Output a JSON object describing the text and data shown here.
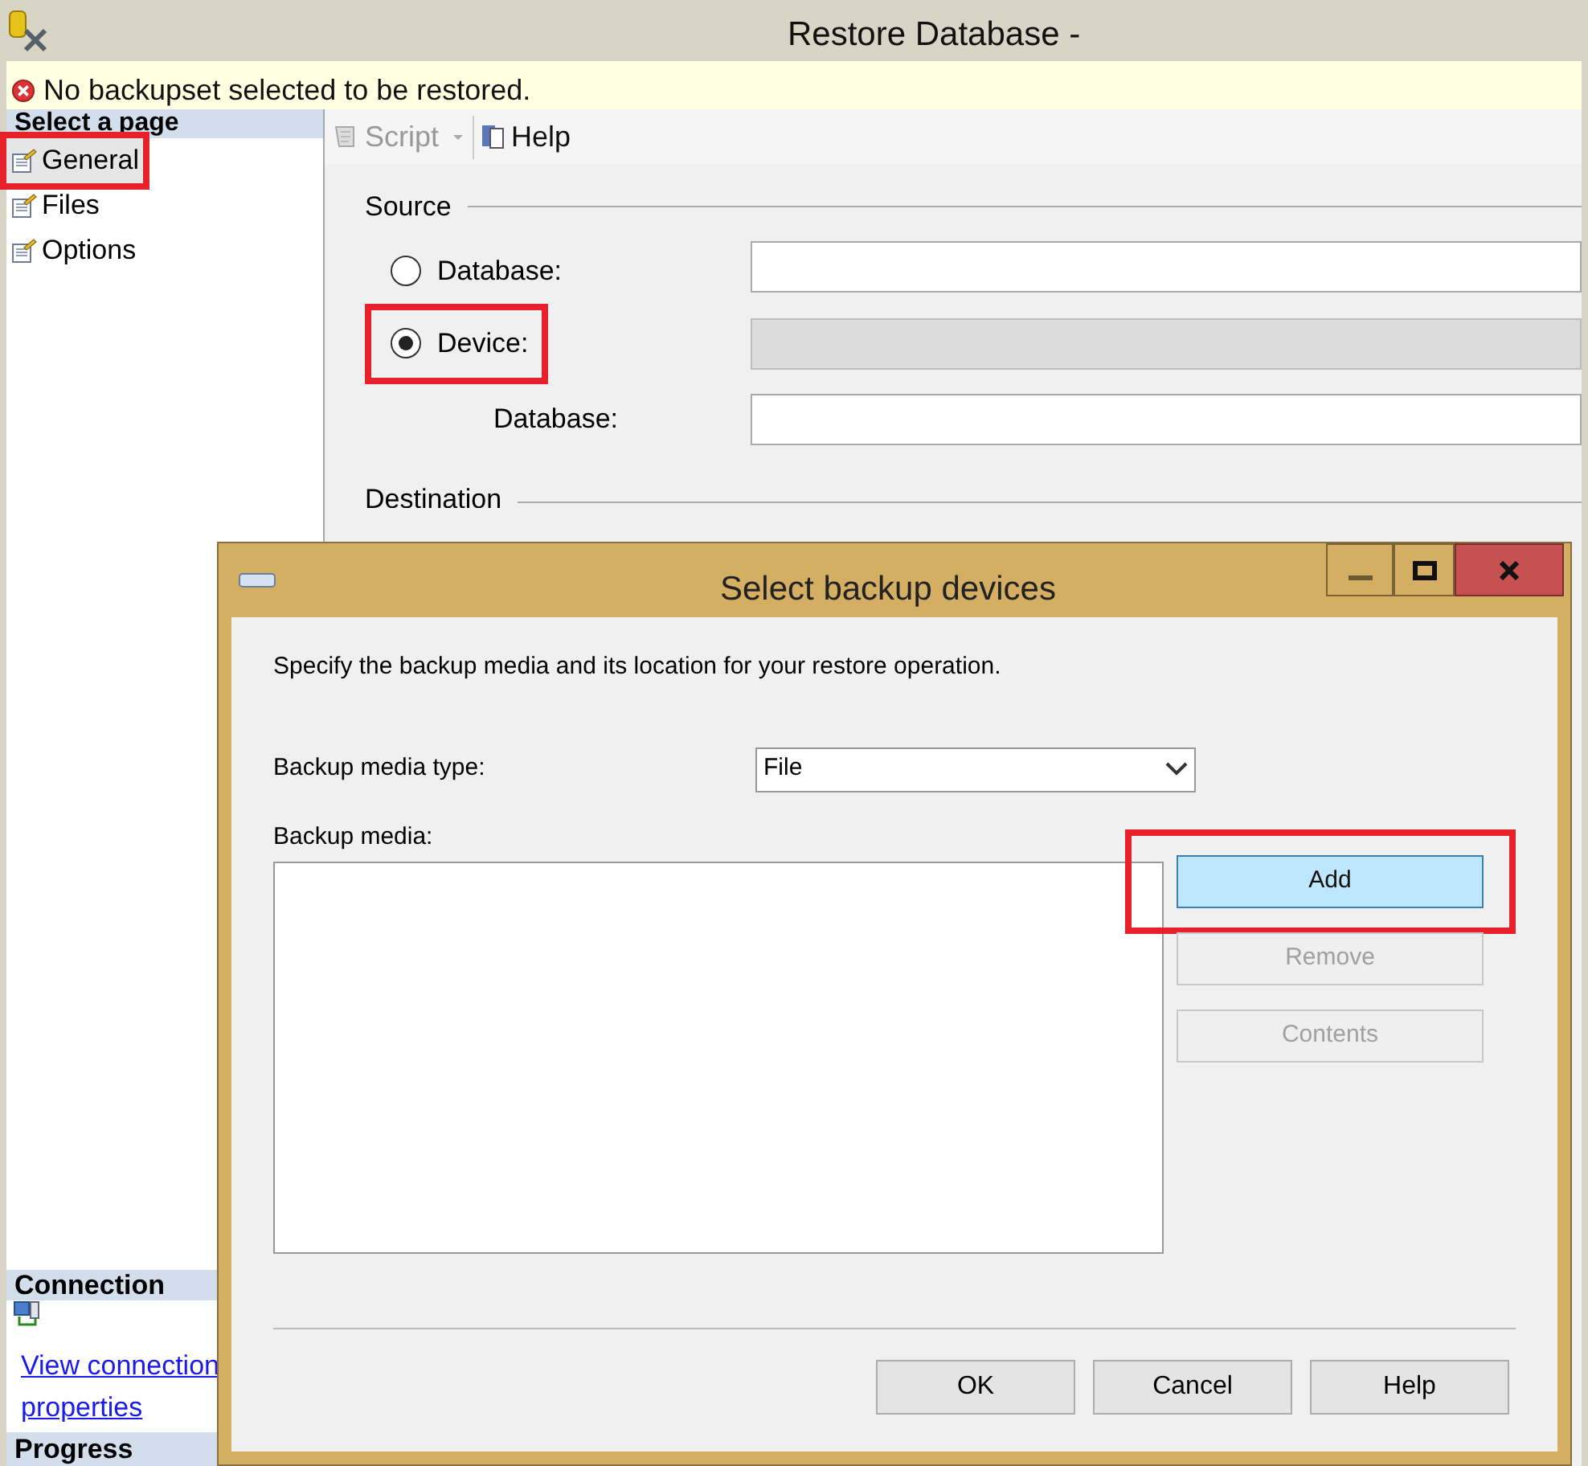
{
  "window": {
    "title": "Restore Database -"
  },
  "error_bar": {
    "message": "No backupset selected to be restored."
  },
  "sidebar": {
    "heading": "Select a page",
    "items": [
      {
        "label": "General",
        "selected": true,
        "highlighted": true
      },
      {
        "label": "Files",
        "selected": false,
        "highlighted": false
      },
      {
        "label": "Options",
        "selected": false,
        "highlighted": false
      }
    ],
    "connection": {
      "heading": "Connection",
      "link": "View connection properties"
    },
    "progress": {
      "heading": "Progress"
    }
  },
  "toolbar": [
    {
      "label": "Script",
      "disabled": true,
      "kind": "script"
    },
    {
      "label": "Help",
      "disabled": false,
      "kind": "help"
    }
  ],
  "source": {
    "title": "Source",
    "options": [
      {
        "label": "Database:",
        "selected": false,
        "highlighted": false,
        "field_disabled": false
      },
      {
        "label": "Device:",
        "selected": true,
        "highlighted": true,
        "field_disabled": true
      }
    ],
    "database_label": "Database:"
  },
  "destination": {
    "title": "Destination"
  },
  "dialog": {
    "title": "Select backup devices",
    "instruction": "Specify the backup media and its location for your restore operation.",
    "media_type_label": "Backup media type:",
    "media_type_value": "File",
    "media_label": "Backup media:",
    "side_buttons": [
      {
        "label": "Add",
        "disabled": false,
        "selected": true,
        "highlighted": true
      },
      {
        "label": "Remove",
        "disabled": true,
        "selected": false,
        "highlighted": false
      },
      {
        "label": "Contents",
        "disabled": true,
        "selected": false,
        "highlighted": false
      }
    ],
    "buttons": [
      "OK",
      "Cancel",
      "Help"
    ]
  }
}
